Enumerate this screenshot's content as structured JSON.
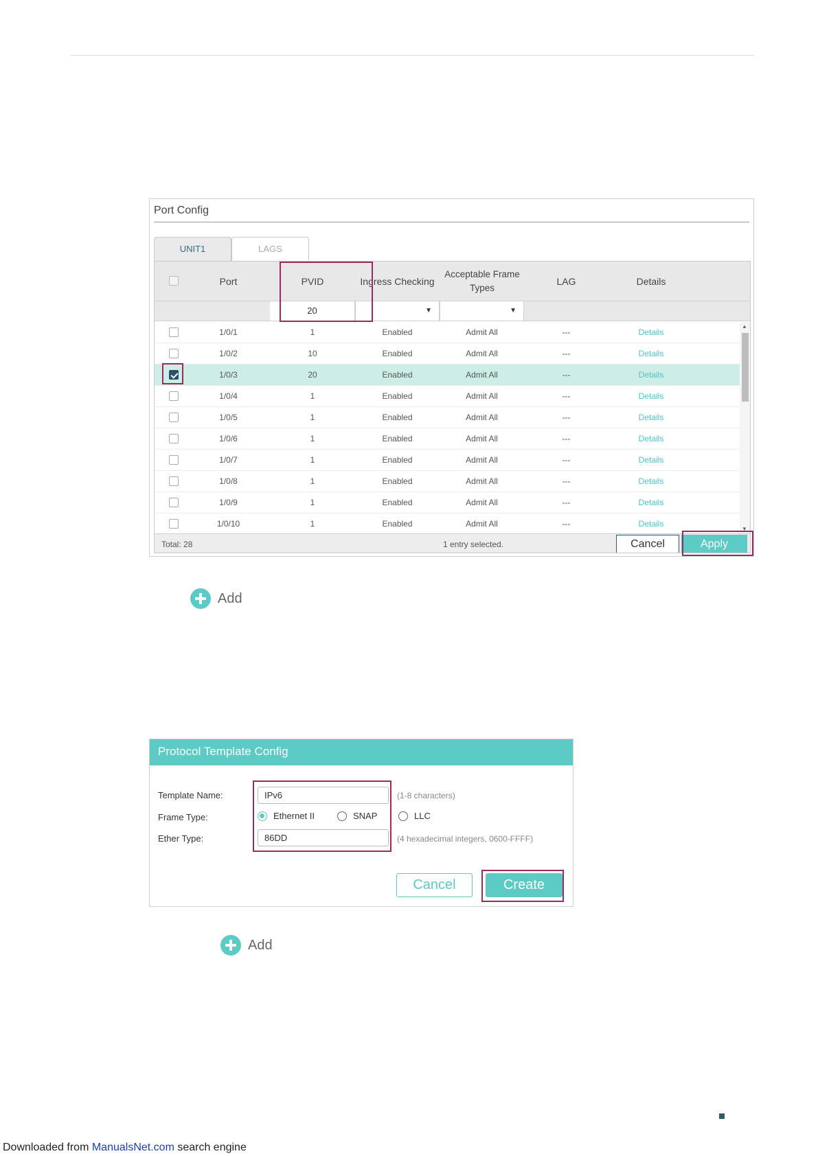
{
  "port_config": {
    "title": "Port Config",
    "tabs": [
      {
        "label": "UNIT1",
        "active": true
      },
      {
        "label": "LAGS",
        "active": false
      }
    ],
    "columns": [
      "Port",
      "PVID",
      "Ingress Checking",
      "Acceptable Frame Types",
      "LAG",
      "Details"
    ],
    "filter": {
      "pvid": "20",
      "ingress": "",
      "frame_types": ""
    },
    "rows": [
      {
        "checked": false,
        "port": "1/0/1",
        "pvid": "1",
        "ingress": "Enabled",
        "frame": "Admit All",
        "lag": "---",
        "details": "Details"
      },
      {
        "checked": false,
        "port": "1/0/2",
        "pvid": "10",
        "ingress": "Enabled",
        "frame": "Admit All",
        "lag": "---",
        "details": "Details"
      },
      {
        "checked": true,
        "port": "1/0/3",
        "pvid": "20",
        "ingress": "Enabled",
        "frame": "Admit All",
        "lag": "---",
        "details": "Details"
      },
      {
        "checked": false,
        "port": "1/0/4",
        "pvid": "1",
        "ingress": "Enabled",
        "frame": "Admit All",
        "lag": "---",
        "details": "Details"
      },
      {
        "checked": false,
        "port": "1/0/5",
        "pvid": "1",
        "ingress": "Enabled",
        "frame": "Admit All",
        "lag": "---",
        "details": "Details"
      },
      {
        "checked": false,
        "port": "1/0/6",
        "pvid": "1",
        "ingress": "Enabled",
        "frame": "Admit All",
        "lag": "---",
        "details": "Details"
      },
      {
        "checked": false,
        "port": "1/0/7",
        "pvid": "1",
        "ingress": "Enabled",
        "frame": "Admit All",
        "lag": "---",
        "details": "Details"
      },
      {
        "checked": false,
        "port": "1/0/8",
        "pvid": "1",
        "ingress": "Enabled",
        "frame": "Admit All",
        "lag": "---",
        "details": "Details"
      },
      {
        "checked": false,
        "port": "1/0/9",
        "pvid": "1",
        "ingress": "Enabled",
        "frame": "Admit All",
        "lag": "---",
        "details": "Details"
      },
      {
        "checked": false,
        "port": "1/0/10",
        "pvid": "1",
        "ingress": "Enabled",
        "frame": "Admit All",
        "lag": "---",
        "details": "Details"
      }
    ],
    "footer": {
      "total": "Total: 28",
      "selected": "1 entry selected.",
      "cancel": "Cancel",
      "apply": "Apply"
    }
  },
  "add_label_1": "Add",
  "protocol_template": {
    "title": "Protocol Template Config",
    "template_name_label": "Template Name:",
    "template_name_value": "IPv6",
    "template_name_hint": "(1-8 characters)",
    "frame_type_label": "Frame Type:",
    "frame_types": [
      {
        "label": "Ethernet II",
        "selected": true
      },
      {
        "label": "SNAP",
        "selected": false
      },
      {
        "label": "LLC",
        "selected": false
      }
    ],
    "ether_type_label": "Ether Type:",
    "ether_type_value": "86DD",
    "ether_type_hint": "(4 hexadecimal integers, 0600-FFFF)",
    "cancel": "Cancel",
    "create": "Create"
  },
  "add_label_2": "Add",
  "download_prefix": "Downloaded from ",
  "download_site": "ManualsNet.com",
  "download_suffix": " search engine",
  "colors": {
    "accent": "#5ccac5",
    "highlight": "#9c2a5c",
    "selected_row": "#cdeee6",
    "link": "#4bc6c6"
  }
}
